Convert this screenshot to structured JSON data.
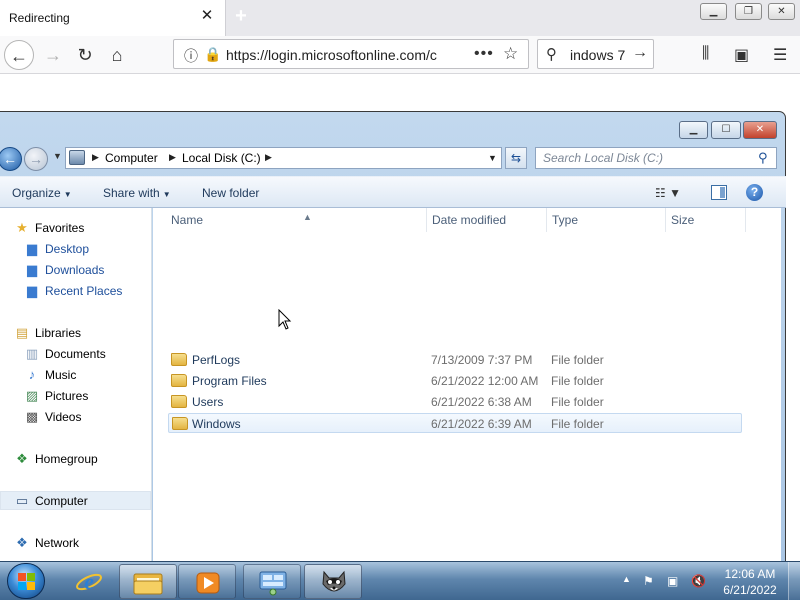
{
  "browser": {
    "tab_title": "Redirecting",
    "url": "https://login.microsoftonline.com/c",
    "search_value": "indows 7"
  },
  "explorer": {
    "breadcrumbs": [
      "Computer",
      "Local Disk (C:)"
    ],
    "search_placeholder": "Search Local Disk (C:)",
    "commands": {
      "organize": "Organize",
      "share_with": "Share with",
      "new_folder": "New folder"
    },
    "nav_pane": {
      "favorites": "Favorites",
      "desktop": "Desktop",
      "downloads": "Downloads",
      "recent_places": "Recent Places",
      "libraries": "Libraries",
      "documents": "Documents",
      "music": "Music",
      "pictures": "Pictures",
      "videos": "Videos",
      "homegroup": "Homegroup",
      "computer": "Computer",
      "network": "Network"
    },
    "columns": {
      "name": "Name",
      "date_modified": "Date modified",
      "type": "Type",
      "size": "Size"
    },
    "rows": [
      {
        "name": "PerfLogs",
        "date": "7/13/2009 7:37 PM",
        "type": "File folder",
        "size": ""
      },
      {
        "name": "Program Files",
        "date": "6/21/2022 12:00 AM",
        "type": "File folder",
        "size": ""
      },
      {
        "name": "Users",
        "date": "6/21/2022 6:38 AM",
        "type": "File folder",
        "size": ""
      },
      {
        "name": "Windows",
        "date": "6/21/2022 6:39 AM",
        "type": "File folder",
        "size": ""
      }
    ]
  },
  "taskbar": {
    "time": "12:06 AM",
    "date": "6/21/2022"
  },
  "colors": {
    "accent": "#1e395b",
    "hover_row": "#e6f0fb",
    "taskbar": "#3f6790"
  }
}
